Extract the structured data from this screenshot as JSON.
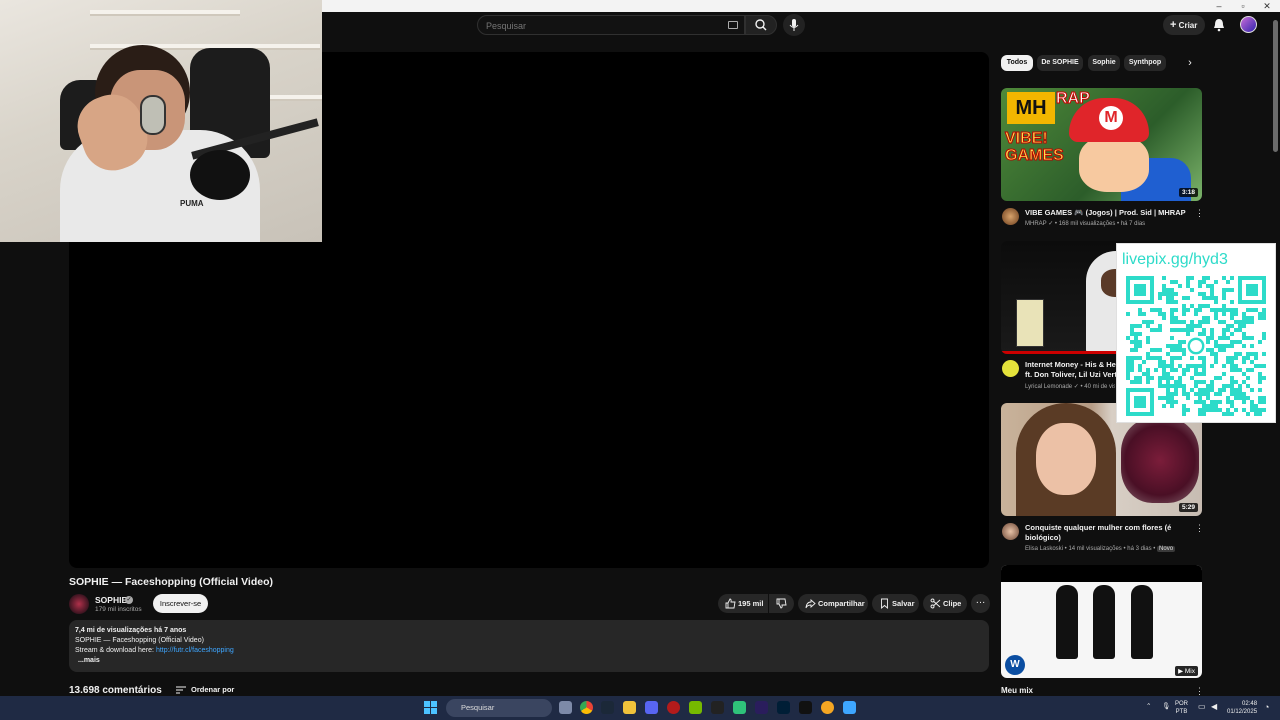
{
  "search": {
    "placeholder": "Pesquisar"
  },
  "header": {
    "create_label": "Criar"
  },
  "webcam": {
    "shirt_text": "PUMA"
  },
  "video": {
    "title": "SOPHIE — Faceshopping (Official Video)",
    "channel": "SOPHIE",
    "subscribers": "179 mil inscritos",
    "subscribe_label": "Inscrever-se",
    "likes": "195 mil",
    "share_label": "Compartilhar",
    "save_label": "Salvar",
    "clip_label": "Clipe"
  },
  "description": {
    "meta": "7,4 mi de visualizações  há 7 anos",
    "line1": "SOPHIE — Faceshopping (Official Video)",
    "line2_prefix": "Stream & download here: ",
    "link": "http://futr.cl/faceshopping",
    "more": "...mais"
  },
  "comments": {
    "count": "13.698 comentários",
    "sort_label": "Ordenar por"
  },
  "chips": [
    "Todos",
    "De SOPHIE",
    "Sophie",
    "Synthpop"
  ],
  "recommendations": [
    {
      "title": "VIBE GAMES 🎮 (Jogos) | Prod. Sid | MHRAP",
      "meta": "MHRAP ✓ • 168 mil visualizações • há 7 dias",
      "duration": "3:18",
      "thumb_text_1": "MH",
      "thumb_text_2": "RAP",
      "thumb_text_3": "VIBE! GAMES"
    },
    {
      "title": "Internet Money - His & Hers ft. Don Toliver, Lil Uzi Vert & Gunna (Official Video)",
      "meta": "Lyrical Lemonade ✓ • 40 mi de visualizações"
    },
    {
      "title": "Conquiste qualquer mulher com flores (é biológico)",
      "meta": "Elisa Laskoski • 14 mil visualizações • há 3 dias • ",
      "badge": "Novo",
      "duration": "5:29"
    },
    {
      "title": "Meu mix",
      "badge": "Mix"
    }
  ],
  "overlay": {
    "livepix": "livepix.gg/hyd3"
  },
  "taskbar": {
    "search_placeholder": "Pesquisar",
    "lang_1": "POR",
    "lang_2": "PTB",
    "time": "02:48",
    "date": "01/12/2025"
  },
  "colors": {
    "accent_link": "#3ea6ff",
    "livepix": "#2ddbc9",
    "background": "#0f0f0f"
  }
}
